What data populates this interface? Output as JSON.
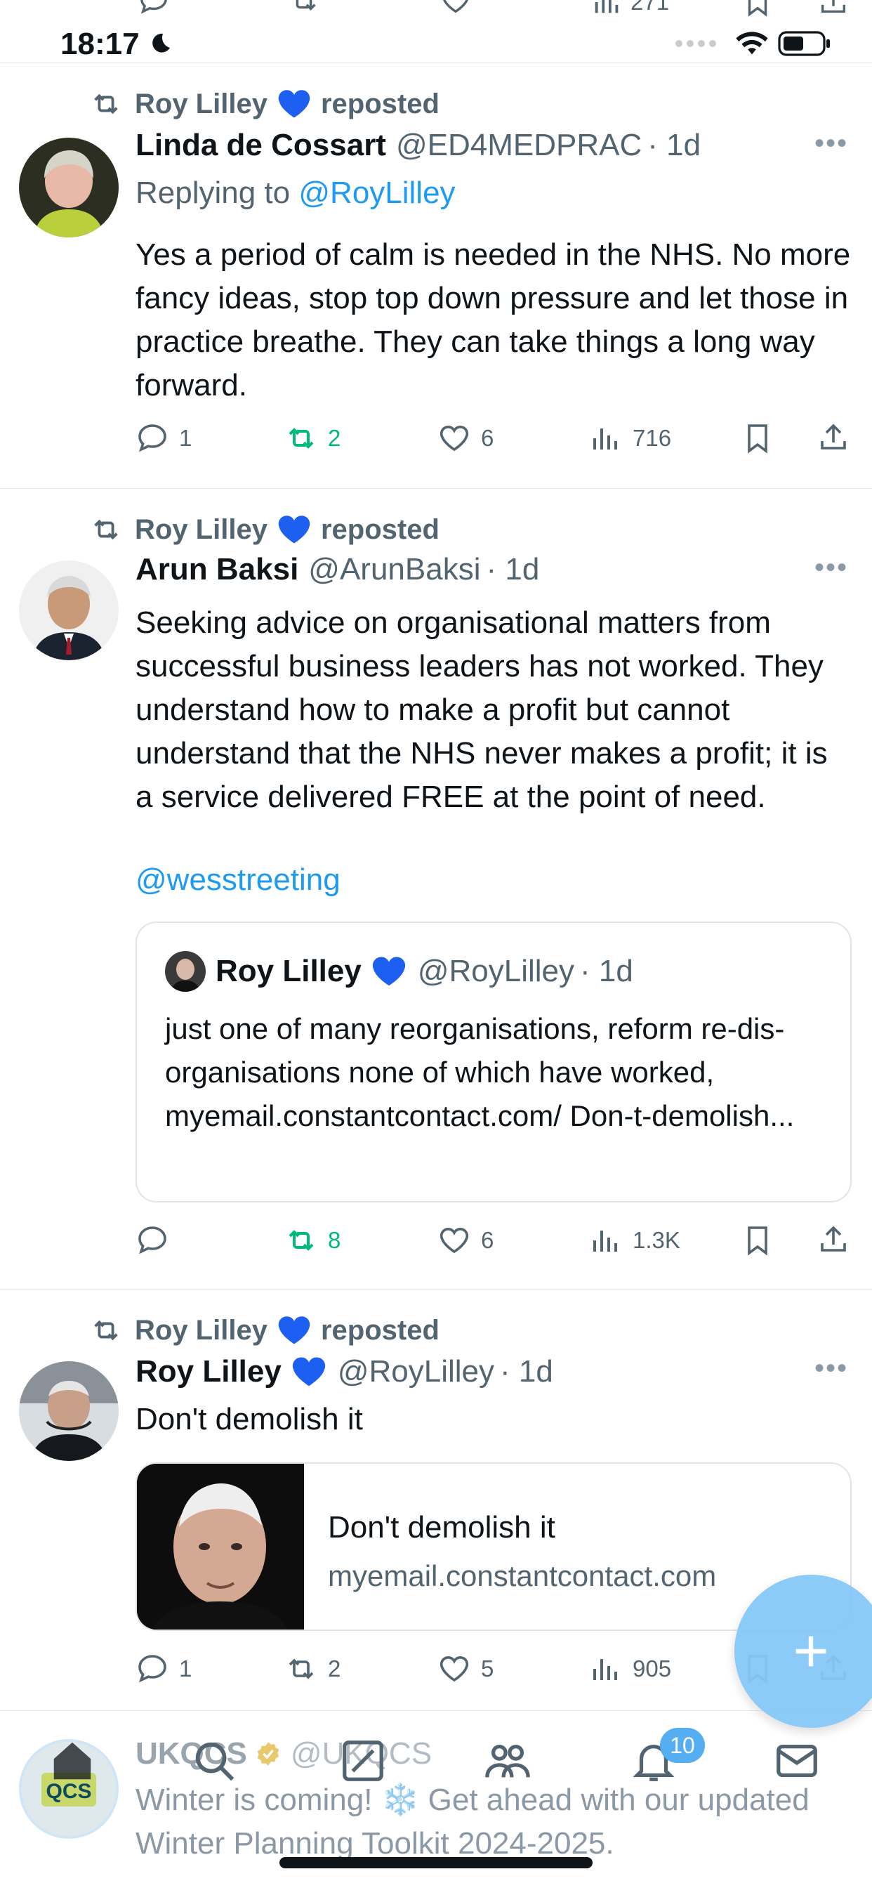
{
  "status_bar": {
    "time": "18:17"
  },
  "top_actions": {
    "views": "271"
  },
  "tweets": [
    {
      "reposted_by": "Roy Lilley",
      "reposted_label": "reposted",
      "name": "Linda de Cossart",
      "handle": "@ED4MEDPRAC",
      "time": "· 1d",
      "replying_prefix": "Replying to",
      "replying_to": "@RoyLilley",
      "text": "Yes a period of calm is needed in the NHS. No more fancy ideas, stop top down pressure and let those in practice breathe. They can take things a long way forward.",
      "replies": "1",
      "reposts": "2",
      "likes": "6",
      "views": "716"
    },
    {
      "reposted_by": "Roy Lilley",
      "reposted_label": "reposted",
      "name": "Arun Baksi",
      "handle": "@ArunBaksi",
      "time": "· 1d",
      "text": "Seeking advice on organisational matters from successful business leaders has not worked. They understand how to make a profit but cannot understand that the NHS never makes a profit; it is a service delivered FREE at the point of need.",
      "mention": "@wesstreeting",
      "quote": {
        "name": "Roy Lilley",
        "handle": "@RoyLilley",
        "time": "· 1d",
        "text": "just one of many reorganisations, reform re-dis-organisations none of which have worked, myemail.constantcontact.com/ Don-t-demolish..."
      },
      "replies": "",
      "reposts": "8",
      "likes": "6",
      "views": "1.3K"
    },
    {
      "reposted_by": "Roy Lilley",
      "reposted_label": "reposted",
      "name": "Roy Lilley",
      "handle": "@RoyLilley",
      "time": "· 1d",
      "text": "Don't demolish it",
      "card": {
        "title": "Don't demolish it",
        "domain": "myemail.constantcontact.com"
      },
      "replies": "1",
      "reposts": "2",
      "likes": "5",
      "views": "905"
    }
  ],
  "faded_tweet": {
    "name": "UKQCS",
    "handle": "@UKQCS",
    "text": "Winter is coming! ❄️ Get ahead with our updated Winter Planning Toolkit 2024-2025.",
    "avatar_label": "QCS"
  },
  "tabbar": {
    "notifications_badge": "10"
  },
  "colors": {
    "accent": "#1d9bf0",
    "repost_green": "#00ba7c",
    "muted": "#536471"
  },
  "icons": [
    "reply-icon",
    "repost-icon",
    "like-icon",
    "views-icon",
    "bookmark-icon",
    "share-icon",
    "home-icon",
    "search-icon",
    "grok-icon",
    "communities-icon",
    "notifications-icon",
    "messages-icon",
    "compose-icon"
  ]
}
